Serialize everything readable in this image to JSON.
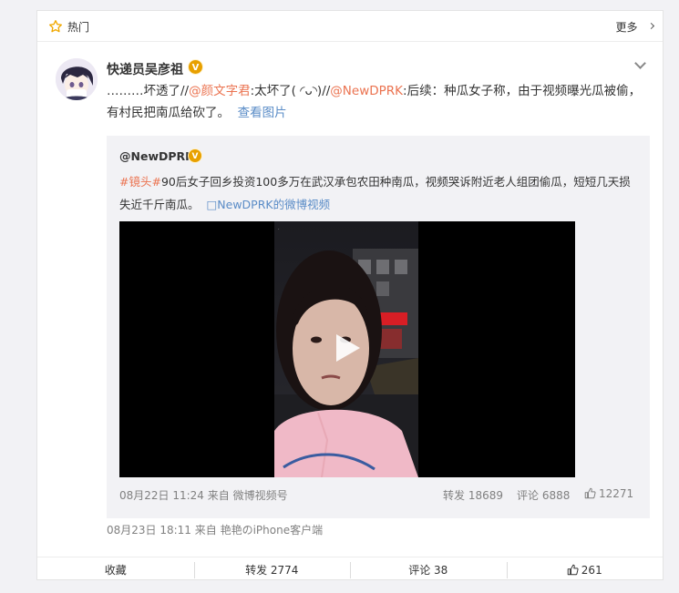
{
  "hot_bar": {
    "label": "热门",
    "more": "更多"
  },
  "post": {
    "author": "快递员吴彦祖",
    "verified_badge": "V",
    "text": {
      "prefix": "………坏透了//",
      "mention1": "@颜文字君",
      "part1": ":太坏了( ◜ᴗ◝)//",
      "mention2": "@NewDPRK",
      "part2": ":后续：种瓜女子称，由于视频曝光瓜被偷，有村民把南瓜给砍了。",
      "view_image": "查看图片"
    },
    "meta": "08月23日 18:11 来自 艳艳のiPhone客户端"
  },
  "quoted": {
    "author": "@NewDPRK",
    "verified_badge": "V",
    "topic": "#镜头#",
    "text": "90后女子回乡投资100多万在武汉承包农田种南瓜，视频哭诉附近老人组团偷瓜，短短几天损失近千斤南瓜。",
    "video_link": "□NewDPRK的微博视频",
    "meta": "08月22日 11:24 来自 微博视频号",
    "repost": "转发 18689",
    "comment": "评论 6888",
    "like": "12271"
  },
  "actions": {
    "favorite": "收藏",
    "repost": "转发 2774",
    "comment": "评论 38",
    "like": "261"
  },
  "colors": {
    "link": "#eb7350",
    "blue_link": "#5a8cc7",
    "badge": "#e8a000"
  }
}
